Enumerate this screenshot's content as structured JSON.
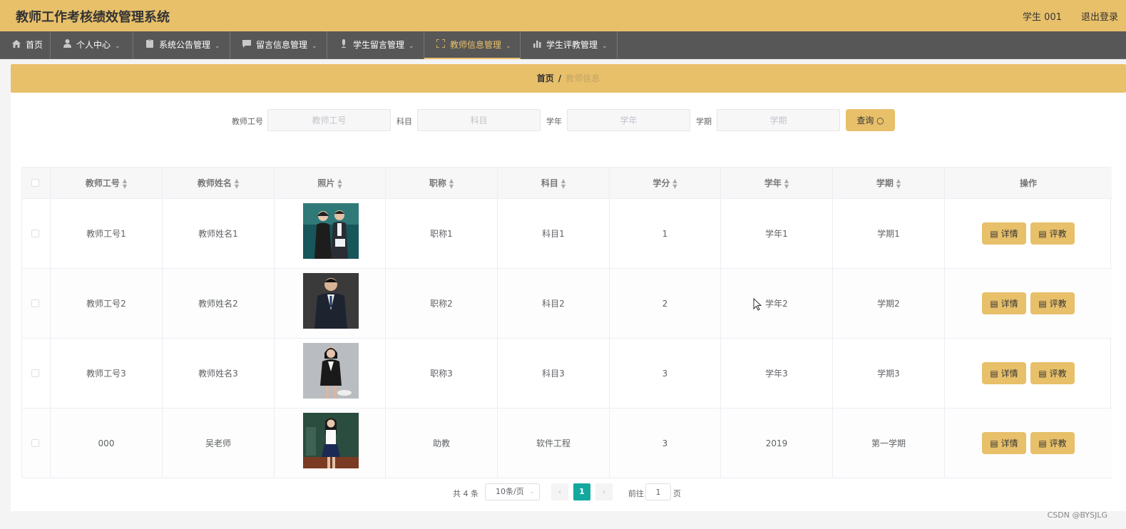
{
  "header": {
    "title": "教师工作考核绩效管理系统",
    "user": "学生 001",
    "logout": "退出登录"
  },
  "nav": [
    {
      "label": "首页",
      "icon": "home-icon"
    },
    {
      "label": "个人中心",
      "icon": "user-icon"
    },
    {
      "label": "系统公告管理",
      "icon": "clipboard-icon"
    },
    {
      "label": "留言信息管理",
      "icon": "message-icon"
    },
    {
      "label": "学生留言管理",
      "icon": "microphone-icon"
    },
    {
      "label": "教师信息管理",
      "icon": "fullscreen-icon"
    },
    {
      "label": "学生评教管理",
      "icon": "chart-icon"
    }
  ],
  "breadcrumb": {
    "home": "首页",
    "sep": "/",
    "current": "教师信息"
  },
  "search": {
    "teacher_id_label": "教师工号",
    "teacher_id_placeholder": "教师工号",
    "subject_label": "科目",
    "subject_placeholder": "科目",
    "year_label": "学年",
    "year_placeholder": "学年",
    "term_label": "学期",
    "term_placeholder": "学期",
    "query_label": "查询 ○"
  },
  "table": {
    "headers": [
      "教师工号",
      "教师姓名",
      "照片",
      "职称",
      "科目",
      "学分",
      "学年",
      "学期",
      "操作"
    ],
    "rows": [
      {
        "id": "教师工号1",
        "name": "教师姓名1",
        "title": "职称1",
        "subject": "科目1",
        "credit": "1",
        "year": "学年1",
        "term": "学期1",
        "photo": "two-teachers-photo"
      },
      {
        "id": "教师工号2",
        "name": "教师姓名2",
        "title": "职称2",
        "subject": "科目2",
        "credit": "2",
        "year": "学年2",
        "term": "学期2",
        "photo": "male-teacher-photo"
      },
      {
        "id": "教师工号3",
        "name": "教师姓名3",
        "title": "职称3",
        "subject": "科目3",
        "credit": "3",
        "year": "学年3",
        "term": "学期3",
        "photo": "female-teacher-photo"
      },
      {
        "id": "000",
        "name": "吴老师",
        "title": "助教",
        "subject": "软件工程",
        "credit": "3",
        "year": "2019",
        "term": "第一学期",
        "photo": "classroom-teacher-photo"
      }
    ],
    "detail_label": "详情",
    "review_label": "评教"
  },
  "pagination": {
    "total": "共 4 条",
    "page_size": "10条/页",
    "prev": "‹",
    "current": "1",
    "next": "›",
    "goto": "前往",
    "goto_value": "1",
    "page_unit": "页"
  },
  "watermark": "CSDN @BYSJLG",
  "colors": {
    "accent": "#e8c06a",
    "nav_bg": "#575757",
    "page_active": "#13a89e"
  }
}
